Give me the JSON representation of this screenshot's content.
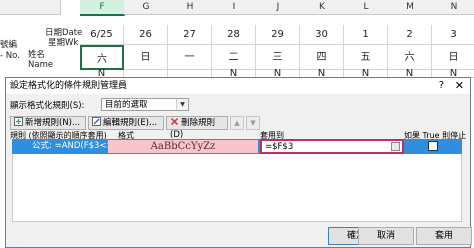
{
  "sheet": {
    "columns": [
      "F",
      "G",
      "H",
      "I",
      "J",
      "K",
      "L",
      "M",
      "N"
    ],
    "selected_column": "F",
    "left_labels": {
      "row1a": "日期Date",
      "row1b": "星期Wk",
      "cut1": "號編",
      "cut2": "- No.",
      "row2a": "姓名",
      "row2b": "Name"
    },
    "dates": [
      "6/25",
      "26",
      "27",
      "28",
      "29",
      "30",
      "1",
      "2",
      "3"
    ],
    "weekdays": [
      "六",
      "日",
      "一",
      "二",
      "三",
      "四",
      "五",
      "六",
      "日"
    ],
    "partial_row": [
      "N",
      "",
      "",
      "N",
      "N",
      "N",
      "N",
      "N",
      "N"
    ]
  },
  "dialog": {
    "title": "設定格式化的條件規則管理員",
    "help": "?",
    "close": "✕",
    "show_rules_label": "顯示格式化規則(S):",
    "show_rules_value": "目前的選取",
    "toolbar": {
      "new_rule": "新增規則(N)...",
      "edit_rule": "編輯規則(E)...",
      "delete_rule": "刪除規則(D)"
    },
    "headers": {
      "rule": "規則 (依照顯示的順序套用)",
      "format": "格式",
      "applies_to": "套用到",
      "stop_if_true": "如果 True 則停止"
    },
    "rule": {
      "text": "公式: =AND(F$3<>...",
      "preview": "AaBbCcYyZz",
      "applies_to": "=$F$3",
      "stop_if_true": false
    },
    "buttons": {
      "ok": "確定",
      "cancel": "取消",
      "apply": "套用"
    }
  }
}
